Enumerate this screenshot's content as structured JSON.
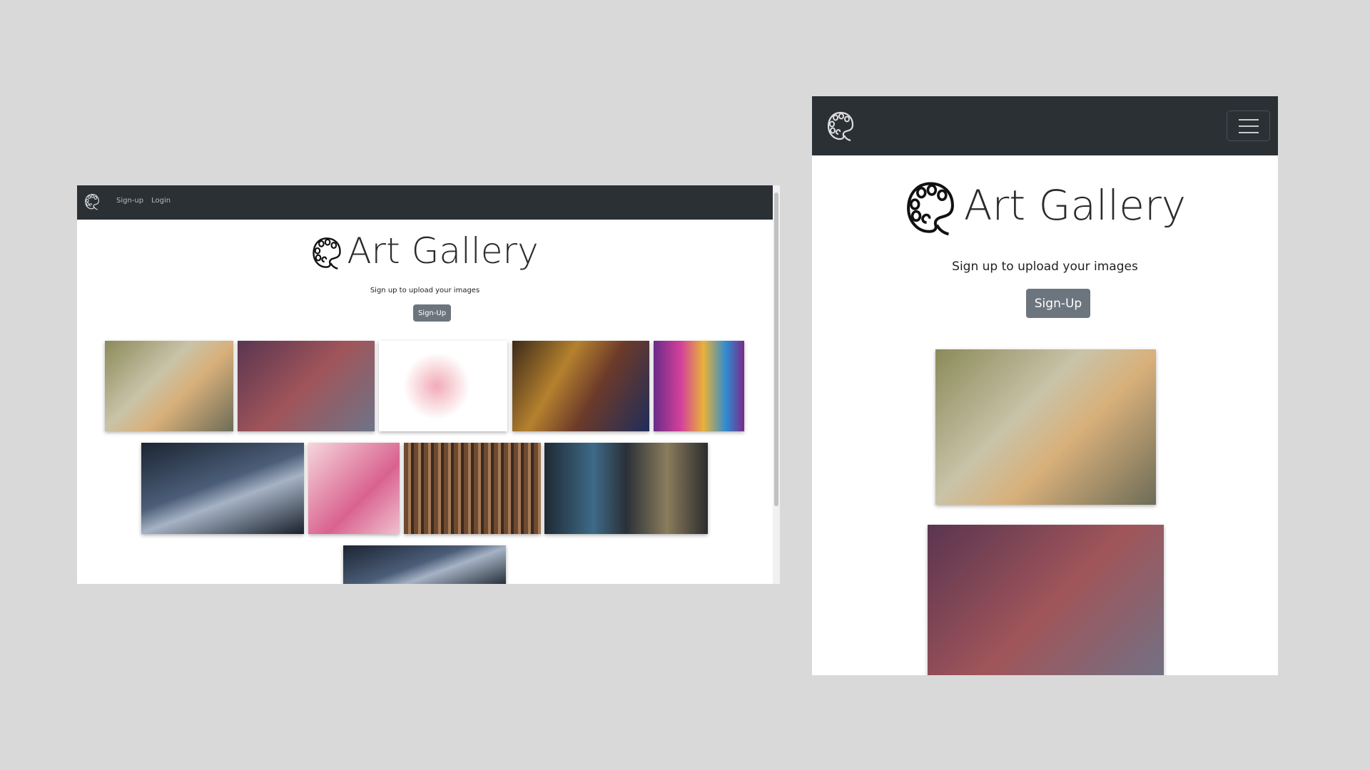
{
  "desktop": {
    "nav": {
      "links": [
        "Sign-up",
        "Login"
      ]
    },
    "title": "Art Gallery",
    "subtitle": "Sign up to upload your images",
    "signup_button": "Sign-Up"
  },
  "mobile": {
    "title": "Art Gallery",
    "subtitle": "Sign up to upload your images",
    "signup_button": "Sign-Up",
    "menu_icon": "hamburger-icon"
  },
  "colors": {
    "navbar": "#2b3035",
    "button": "#6c757d",
    "background": "#d9d9d9"
  }
}
